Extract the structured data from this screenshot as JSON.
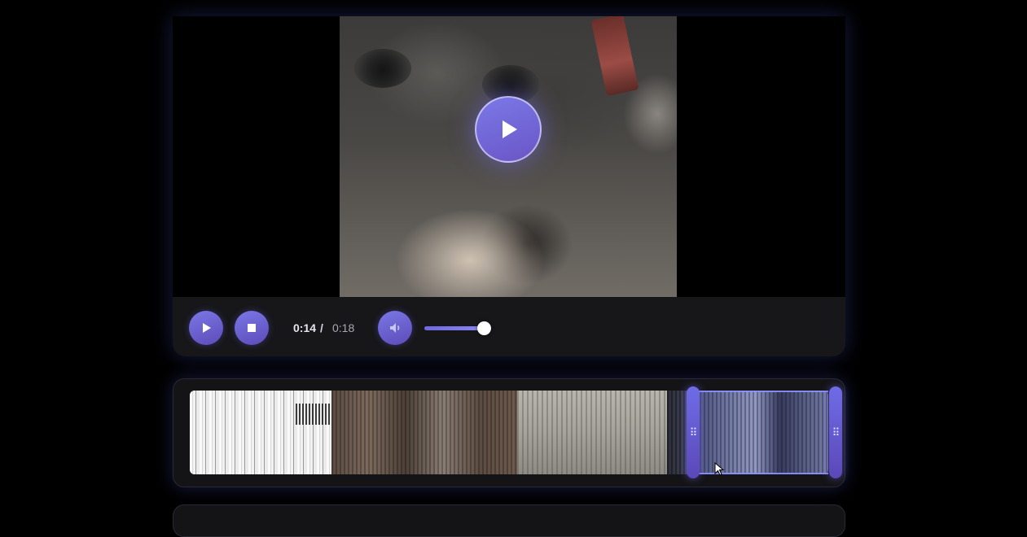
{
  "player": {
    "time_current": "0:14",
    "time_separator": "/",
    "time_total": "0:18",
    "volume_level": 1.0,
    "icons": {
      "big_play": "play-icon",
      "play": "play-icon",
      "stop": "stop-icon",
      "volume": "speaker-icon"
    }
  },
  "timeline": {
    "thumbnail_count": 4,
    "selection_start_fraction": 0.78,
    "selection_end_fraction": 1.0
  },
  "colors": {
    "accent": "#6f6ce6",
    "accent_dark": "#5b48b8",
    "background": "#000000",
    "card": "#161618"
  }
}
